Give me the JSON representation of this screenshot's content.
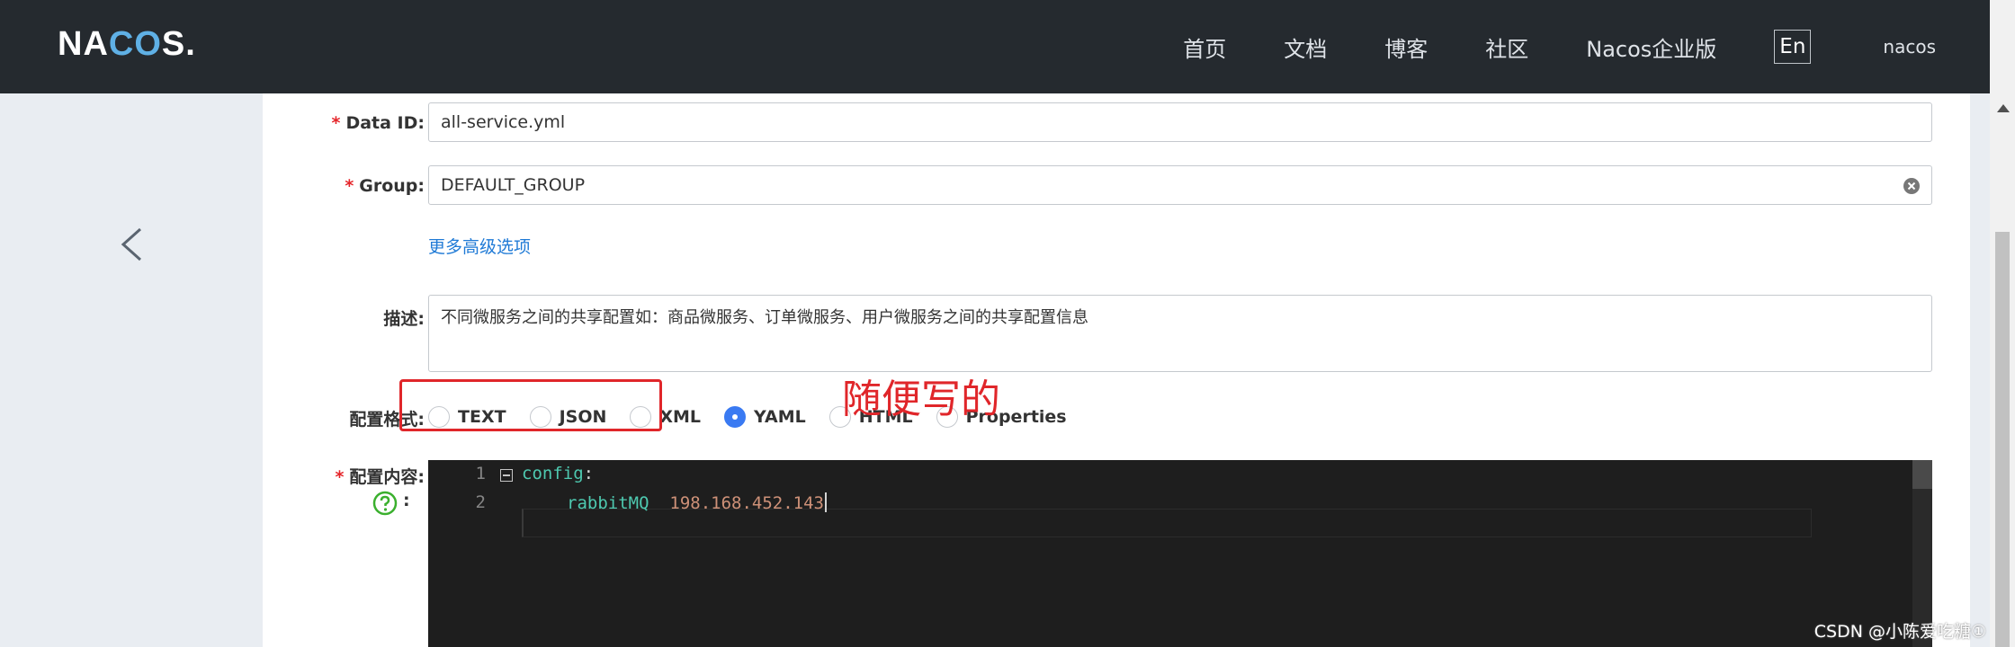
{
  "header": {
    "logo": {
      "left": "NA",
      "mid": "CO",
      "right": "S."
    },
    "nav": [
      "首页",
      "文档",
      "博客",
      "社区",
      "Nacos企业版"
    ],
    "lang_button": "En",
    "user": "nacos"
  },
  "form": {
    "data_id": {
      "label": "Data ID:",
      "value": "all-service.yml"
    },
    "group": {
      "label": "Group:",
      "value": "DEFAULT_GROUP"
    },
    "advanced_link": "更多高级选项",
    "description": {
      "label": "描述:",
      "value": "不同微服务之间的共享配置如：商品微服务、订单微服务、用户微服务之间的共享配置信息"
    },
    "format": {
      "label": "配置格式:",
      "options": [
        "TEXT",
        "JSON",
        "XML",
        "YAML",
        "HTML",
        "Properties"
      ],
      "selected": "YAML"
    },
    "content": {
      "label": "配置内容:",
      "help_colon": ":",
      "lines": [
        {
          "num": "1",
          "key": "config",
          "punct": ":",
          "value": ""
        },
        {
          "num": "2",
          "key": "rabbitMQ",
          "punct": "",
          "value": "198.168.452.143"
        }
      ]
    }
  },
  "annotation": "随便写的",
  "watermark": "CSDN @小陈爱吃糖①",
  "colors": {
    "header_bg": "#252a2f",
    "accent": "#3a7af2",
    "required": "#e5252a",
    "annotation": "#e0262a"
  }
}
